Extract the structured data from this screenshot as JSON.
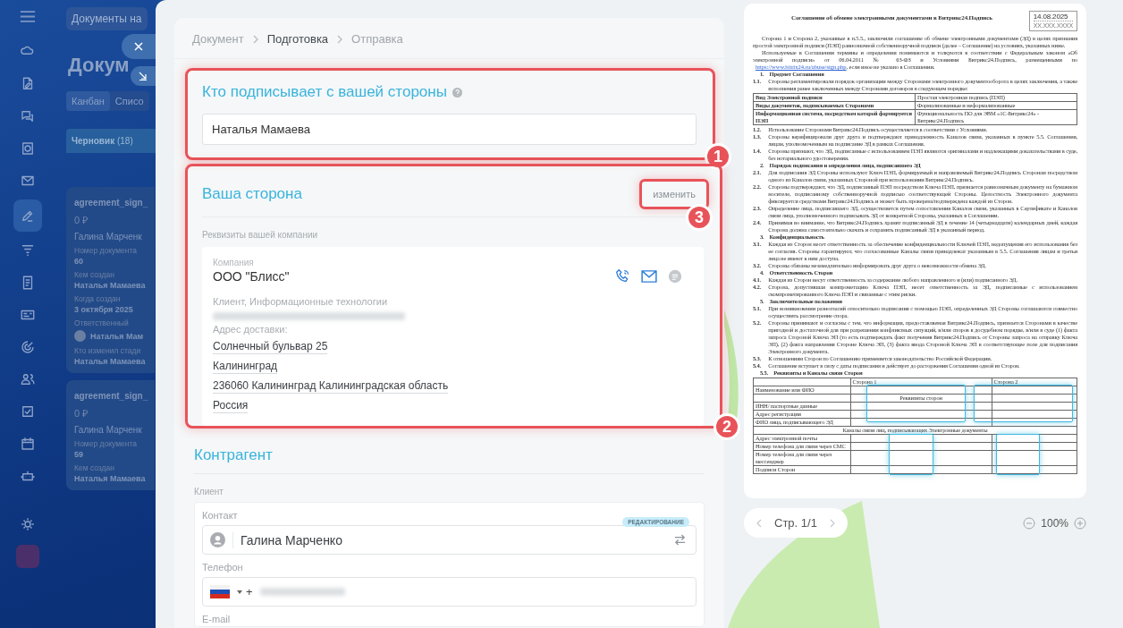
{
  "sidebar": {
    "items": [
      {
        "selected": false
      },
      {
        "selected": false
      },
      {
        "selected": false
      },
      {
        "selected": false
      },
      {
        "selected": false
      },
      {
        "selected": true
      },
      {
        "selected": false
      },
      {
        "selected": false
      },
      {
        "selected": false
      },
      {
        "selected": false
      },
      {
        "selected": false
      },
      {
        "selected": false
      },
      {
        "selected": false
      },
      {
        "selected": false
      },
      {
        "selected": false
      },
      {
        "selected": false
      }
    ]
  },
  "background_page": {
    "search_chip": "Документы на",
    "title": "Докум",
    "view_tabs": [
      {
        "label": "Канбан",
        "selected": true
      },
      {
        "label": "Списо",
        "selected": false
      }
    ],
    "column": {
      "title": "Черновик",
      "count": "(18)"
    },
    "cards": [
      {
        "title": "agreement_sign_",
        "sum": "0 ₽",
        "client": "Галина Марченк",
        "fields": [
          {
            "label": "Номер документа",
            "value": "60"
          },
          {
            "label": "Кем создан",
            "value": "Наталья Мамаева"
          },
          {
            "label": "Когда создан",
            "value": "3 октября 2025"
          },
          {
            "label": "Ответственный",
            "value": "Наталья Мам",
            "kind": "person"
          },
          {
            "label": "Кто изменил стади",
            "value": "Наталья Мамаева"
          }
        ]
      },
      {
        "title": "agreement_sign_",
        "sum": "0 ₽",
        "client": "Галина Марченк",
        "fields": [
          {
            "label": "Номер документа",
            "value": "59"
          },
          {
            "label": "Кем создан",
            "value": "Наталья Мамаева"
          }
        ]
      }
    ]
  },
  "breadcrumbs": [
    {
      "label": "Документ",
      "selected": false
    },
    {
      "label": "Подготовка",
      "selected": true
    },
    {
      "label": "Отправка",
      "selected": false
    }
  ],
  "signer_section": {
    "title": "Кто подписывает с вашей стороны",
    "value": "Наталья Мамаева",
    "callout": "1"
  },
  "our_side": {
    "title": "Ваша сторона",
    "change_link": "изменить",
    "change_callout": "3",
    "callout": "2",
    "subtitle": "Реквизиты вашей компании",
    "company": {
      "label": "Компания",
      "name": "ООО \"Блисс\"",
      "type": "Клиент, Информационные технологии",
      "address_label": "Адрес доставки:",
      "address_lines": [
        "Солнечный бульвар 25",
        "Калининград",
        "236060 Калининград Калининградская область",
        "Россия"
      ]
    }
  },
  "counterparty": {
    "title": "Контрагент",
    "subtitle": "Клиент",
    "contact_label": "Контакт",
    "contact_badge": "РЕДАКТИРОВАНИЕ",
    "contact_name": "Галина Марченко",
    "phone_label": "Телефон",
    "phone_prefix": "+",
    "email_label": "E-mail"
  },
  "document_preview": {
    "title": "Соглашение об обмене электронными документами в Битрикс24.Подпись",
    "date": "14.08.2025",
    "date_placeholder": "XX.XXX.XXXX",
    "blocks": [
      {
        "kind": "para",
        "text": "Сторона 1 и Сторона 2, указанные в п.5.5., заключили соглашение об обмене электронными документами (ЭД) в целях признания простой электронной подписи (ПЭП) равнозначной собственноручной подписи (далее – Соглашение) на условиях, указанных ниже."
      },
      {
        "kind": "para",
        "text": "Используемые в Соглашении термины и определения понимаются и толкуются в соответствии с Федеральным законом «Об электронной подписи» от 06.04.2011 № 63-ФЗ и Условиями Битрикс24.Подпись, размещенными по",
        "link": "https://www.bitrix24.ru/abuse/sign.php",
        "tail": ", если иное не указано в Соглашении."
      },
      {
        "kind": "heading",
        "num": "1.",
        "text": "Предмет Соглашения"
      },
      {
        "kind": "item",
        "num": "1.1.",
        "text": "Стороны регламентировали порядок организации между Сторонами электронного документооборота в целях заключения, а также исполнения ранее заключенных между Сторонами договоров в следующем порядке:"
      },
      {
        "kind": "table",
        "rows": [
          [
            "Вид Электронной подписи",
            "Простая электронная подпись (ПЭП)"
          ],
          [
            "Виды документов, подписываемых Сторонами",
            "Формализованные и неформализованные"
          ],
          [
            "Информационная система, посредством которой формируется ПЭП",
            "Функциональность ПО для ЭВМ «1С-Битрикс24» - Битрикс24.Подпись"
          ]
        ]
      },
      {
        "kind": "item",
        "num": "1.2.",
        "text": "Использование Сторонами Битрикс24.Подпись осуществляется в соответствии с Условиями."
      },
      {
        "kind": "item",
        "num": "1.3.",
        "text": "Стороны верифицировали друг друга и подтверждают принадлежность Каналов связи, указанных в пункте 5.5. Соглашения, лицам, уполномоченным на подписание ЭД в рамках Соглашения."
      },
      {
        "kind": "item",
        "num": "1.4.",
        "text": "Стороны признают, что ЭД, подписанные с использованием ПЭП являются оригиналами и надлежащими доказательствами в суде, без нотариального удостоверения."
      },
      {
        "kind": "heading",
        "num": "2.",
        "text": "Порядок подписания и определения лица, подписавшего ЭД"
      },
      {
        "kind": "item",
        "num": "2.1.",
        "text": "Для подписания ЭД Стороны используют Ключ ПЭП, формируемый и направляемый Битрикс24.Подпись Сторонам посредством одного из Каналов связи, указанных Стороной при использовании Битрикс24.Подпись."
      },
      {
        "kind": "item",
        "num": "2.2.",
        "text": "Стороны подтверждают, что ЭД, подписанный ПЭП посредством Ключа ПЭП, признается равнозначным документу на бумажном носителе, подписанному собственноручной подписью соответствующей Стороны. Целостность Электронного документа фиксируется средствами Битрикс24.Подпись и может быть проверена/подтверждена каждой из Сторон."
      },
      {
        "kind": "item",
        "num": "2.3.",
        "text": "Определение лица, подписавшего ЭД, осуществляется путем сопоставления Каналов связи, указанных в Сертификате и Каналов связи лица, уполномоченного подписывать ЭД от конкретной Стороны, указанных в Соглашении."
      },
      {
        "kind": "item",
        "num": "2.4.",
        "text": "Принимая во внимание, что Битрикс24.Подпись хранит подписанный ЭД в течение 14 (четырнадцати) календарных дней, каждая Сторона должна самостоятельно скачать и сохранить подписанный ЭД в указанный период."
      },
      {
        "kind": "heading",
        "num": "3.",
        "text": "Конфиденциальность"
      },
      {
        "kind": "item",
        "num": "3.1.",
        "text": "Каждая из Сторон несет ответственность за обеспечение конфиденциальности Ключей ПЭП, недопущения его использования без ее согласия. Стороны гарантируют, что согласованные Каналы связи принадлежат указанным в 5.5. Соглашения лицам и третьи лица не имеют к ним доступа."
      },
      {
        "kind": "item",
        "num": "3.2.",
        "text": "Стороны обязаны незамедлительно информировать друг друга о невозможности обмена ЭД."
      },
      {
        "kind": "heading",
        "num": "4.",
        "text": "Ответственность Сторон"
      },
      {
        "kind": "item",
        "num": "4.1.",
        "text": "Каждая из Сторон несут ответственность за содержание любого направленного и (или) подписанного ЭД."
      },
      {
        "kind": "item",
        "num": "4.2.",
        "text": "Сторона, допустившая компрометацию Ключа ПЭП, несет ответственность за ЭД, подписанные с использованием скомпрометированного Ключа ПЭП и связанные с этим риски."
      },
      {
        "kind": "heading",
        "num": "5.",
        "text": "Заключительные положения"
      },
      {
        "kind": "item",
        "num": "5.1.",
        "text": "При возникновении разногласий относительно подписания с помощью ПЭП, определенных ЭД Стороны соглашаются совместно осуществить рассмотрение спора."
      },
      {
        "kind": "item",
        "num": "5.2.",
        "text": "Стороны принимают и согласны с тем, что информация, предоставляемая Битрикс24.Подпись, признается Сторонами в качестве пригодной и достаточной для при разрешении конфликтных ситуаций, в/или споров в досудебном порядке, в/или в суде (1) факта запроса Стороной Ключа ЭП (то есть подтверждать факт получения Битрикс24.Подпись от Стороны запроса на отправку Ключа ЭП), (2) факта направления Стороне Ключа ЭП, (3) факта ввода Стороной Ключа ЭП в соответствующее поле для подписания Электронного документа."
      },
      {
        "kind": "item",
        "num": "5.3.",
        "text": "К отношениям Сторон по Соглашению применяется законодательство Российской Федерации."
      },
      {
        "kind": "item",
        "num": "5.4.",
        "text": "Соглашение вступает в силу с даты подписания и действует до расторжения Соглашения одной из Сторон."
      },
      {
        "kind": "heading",
        "num": "5.5.",
        "text": "Реквизиты и Каналы связи Сторон"
      },
      {
        "kind": "requisites",
        "header": [
          "Сторона 1",
          "Сторона 2"
        ],
        "rows": [
          {
            "kind": "row",
            "label": "Наименование или ФИО"
          },
          {
            "kind": "note",
            "text": "Реквизиты сторон"
          },
          {
            "kind": "row",
            "label": "ИНН/ паспортные данные"
          },
          {
            "kind": "row",
            "label": "Адрес регистрации"
          },
          {
            "kind": "row",
            "label": "ФИО лица, подписывающего ЭД"
          },
          {
            "kind": "merged",
            "text": "Каналы связи лиц, подписывающих Электронные документы"
          },
          {
            "kind": "row",
            "label": "Адрес электронной почты"
          },
          {
            "kind": "row",
            "label": "Номер телефона для связи через СМС"
          },
          {
            "kind": "row",
            "label": "Номер телефона для связи через мессенджер"
          },
          {
            "kind": "row",
            "label": "Подписи Сторон"
          }
        ]
      }
    ]
  },
  "pager": {
    "label": "Стр. 1/1",
    "zoom": "100%"
  }
}
